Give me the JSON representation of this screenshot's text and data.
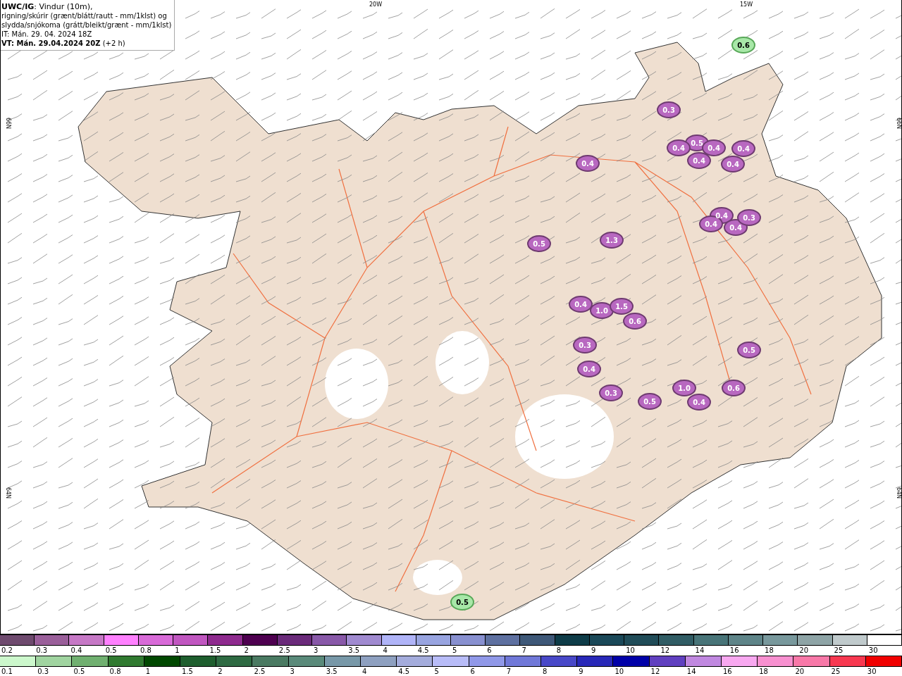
{
  "title_box": {
    "lines": [
      "**UWC/IG**: Vindur (10m),",
      "rigning/skúrir (grænt/blátt/rautt - mm/1klst) og",
      "slydda/snjókoma (grátt/bleikt/grænt - mm/1klst)",
      "IT: Mán. 29. 04. 2024 18Z",
      "**VT: Mán. 29.04.2024 20Z** (+2 h)"
    ]
  },
  "map": {
    "longitude_labels": [
      "20W",
      "15W"
    ],
    "latitude_labels_left": [
      "66N",
      "64N"
    ],
    "latitude_labels_right": [
      "66N",
      "64N"
    ],
    "precipitation_labels": [
      {
        "value": "0.6",
        "kind": "rain"
      },
      {
        "value": "0.5",
        "kind": "rain"
      },
      {
        "value": "1.3",
        "kind": "snow"
      },
      {
        "value": "0.5",
        "kind": "snow"
      },
      {
        "value": "0.4",
        "kind": "snow"
      },
      {
        "value": "1.0",
        "kind": "snow"
      },
      {
        "value": "1.5",
        "kind": "snow"
      },
      {
        "value": "0.6",
        "kind": "snow"
      },
      {
        "value": "0.3",
        "kind": "snow"
      },
      {
        "value": "0.4",
        "kind": "snow"
      },
      {
        "value": "0.3",
        "kind": "snow"
      },
      {
        "value": "0.5",
        "kind": "snow"
      },
      {
        "value": "1.0",
        "kind": "snow"
      },
      {
        "value": "0.4",
        "kind": "snow"
      },
      {
        "value": "0.6",
        "kind": "snow"
      },
      {
        "value": "0.5",
        "kind": "snow"
      },
      {
        "value": "0.3",
        "kind": "snow"
      },
      {
        "value": "0.5",
        "kind": "snow"
      },
      {
        "value": "0.4",
        "kind": "snow"
      },
      {
        "value": "0.4",
        "kind": "snow"
      },
      {
        "value": "0.4",
        "kind": "snow"
      },
      {
        "value": "0.4",
        "kind": "snow"
      },
      {
        "value": "0.4",
        "kind": "snow"
      },
      {
        "value": "0.4",
        "kind": "snow"
      },
      {
        "value": "0.4",
        "kind": "snow"
      },
      {
        "value": "0.4",
        "kind": "snow"
      },
      {
        "value": "0.3",
        "kind": "snow"
      },
      {
        "value": "0.4",
        "kind": "snow"
      }
    ]
  },
  "colorbars": [
    {
      "segments": [
        {
          "color": "#6e4a6e",
          "label": "0.2"
        },
        {
          "color": "#9a5f9a",
          "label": "0.3"
        },
        {
          "color": "#c678c6",
          "label": "0.4"
        },
        {
          "color": "#ff80ff",
          "label": "0.5"
        },
        {
          "color": "#d86ad8",
          "label": "0.8"
        },
        {
          "color": "#c056c0",
          "label": "1"
        },
        {
          "color": "#8e2a8e",
          "label": "1.5"
        },
        {
          "color": "#4e0050",
          "label": "2"
        },
        {
          "color": "#6a2a7a",
          "label": "2.5"
        },
        {
          "color": "#8858a8",
          "label": "3"
        },
        {
          "color": "#a08ad0",
          "label": "3.5"
        },
        {
          "color": "#b0b4f8",
          "label": "4"
        },
        {
          "color": "#98a4e0",
          "label": "4.5"
        },
        {
          "color": "#8890d0",
          "label": "5"
        },
        {
          "color": "#5e70a0",
          "label": "6"
        },
        {
          "color": "#3e5878",
          "label": "7"
        },
        {
          "color": "#0e3c48",
          "label": "8"
        },
        {
          "color": "#1a4858",
          "label": "9"
        },
        {
          "color": "#204c58",
          "label": "10"
        },
        {
          "color": "#305c64",
          "label": "12"
        },
        {
          "color": "#487478",
          "label": "14"
        },
        {
          "color": "#5e8488",
          "label": "16"
        },
        {
          "color": "#78989c",
          "label": "18"
        },
        {
          "color": "#8ea4a6",
          "label": "20"
        },
        {
          "color": "#c0cacc",
          "label": "25"
        },
        {
          "color": "#ffffff",
          "label": "30"
        }
      ]
    },
    {
      "segments": [
        {
          "color": "#ccf8cc",
          "label": "0.1"
        },
        {
          "color": "#a0d4a0",
          "label": "0.3"
        },
        {
          "color": "#70b070",
          "label": "0.5"
        },
        {
          "color": "#307a30",
          "label": "0.8"
        },
        {
          "color": "#004800",
          "label": "1"
        },
        {
          "color": "#1e5e2e",
          "label": "1.5"
        },
        {
          "color": "#2e6a42",
          "label": "2"
        },
        {
          "color": "#4a7a62",
          "label": "2.5"
        },
        {
          "color": "#5a8a7a",
          "label": "3"
        },
        {
          "color": "#7898a8",
          "label": "3.5"
        },
        {
          "color": "#8ea0c0",
          "label": "4"
        },
        {
          "color": "#a4acdc",
          "label": "4.5"
        },
        {
          "color": "#b8bcf8",
          "label": "5"
        },
        {
          "color": "#9098e8",
          "label": "6"
        },
        {
          "color": "#7078d8",
          "label": "7"
        },
        {
          "color": "#4848c8",
          "label": "8"
        },
        {
          "color": "#2828b8",
          "label": "9"
        },
        {
          "color": "#0000a8",
          "label": "10"
        },
        {
          "color": "#6040c0",
          "label": "12"
        },
        {
          "color": "#c088e0",
          "label": "14"
        },
        {
          "color": "#f8a8f0",
          "label": "16"
        },
        {
          "color": "#f890d0",
          "label": "18"
        },
        {
          "color": "#f878a8",
          "label": "20"
        },
        {
          "color": "#f83850",
          "label": "25"
        },
        {
          "color": "#f00000",
          "label": "30"
        }
      ]
    }
  ]
}
